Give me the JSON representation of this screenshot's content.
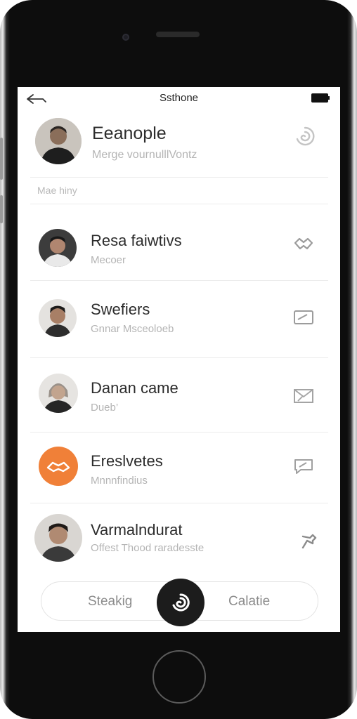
{
  "status": {
    "title": "Ssthone"
  },
  "profile": {
    "name": "Eeanople",
    "subtitle": "Merge vournulllVontz"
  },
  "section": {
    "label": "Mae hiny"
  },
  "contacts": [
    {
      "name": "Resa faiwtivs",
      "sub": "Mecoer",
      "icon": "handshake-icon"
    },
    {
      "name": "Swefiers",
      "sub": "Gnnar Msceoloeb",
      "icon": "card-icon"
    },
    {
      "name": "Danan came",
      "sub": "Dueb’",
      "icon": "mail-icon"
    },
    {
      "name": "Ereslvetes",
      "sub": "Mnnnfindius",
      "icon": "chat-icon"
    },
    {
      "name": "Varmalndurat",
      "sub": "Offest Thood raradesste",
      "icon": "pin-icon"
    }
  ],
  "bottom_bar": {
    "left_label": "Steakig",
    "right_label": "Calatie"
  },
  "colors": {
    "accent": "#f08038",
    "text": "#2c2c2c",
    "muted": "#b4b4b4",
    "icon": "#a8a8a8"
  }
}
